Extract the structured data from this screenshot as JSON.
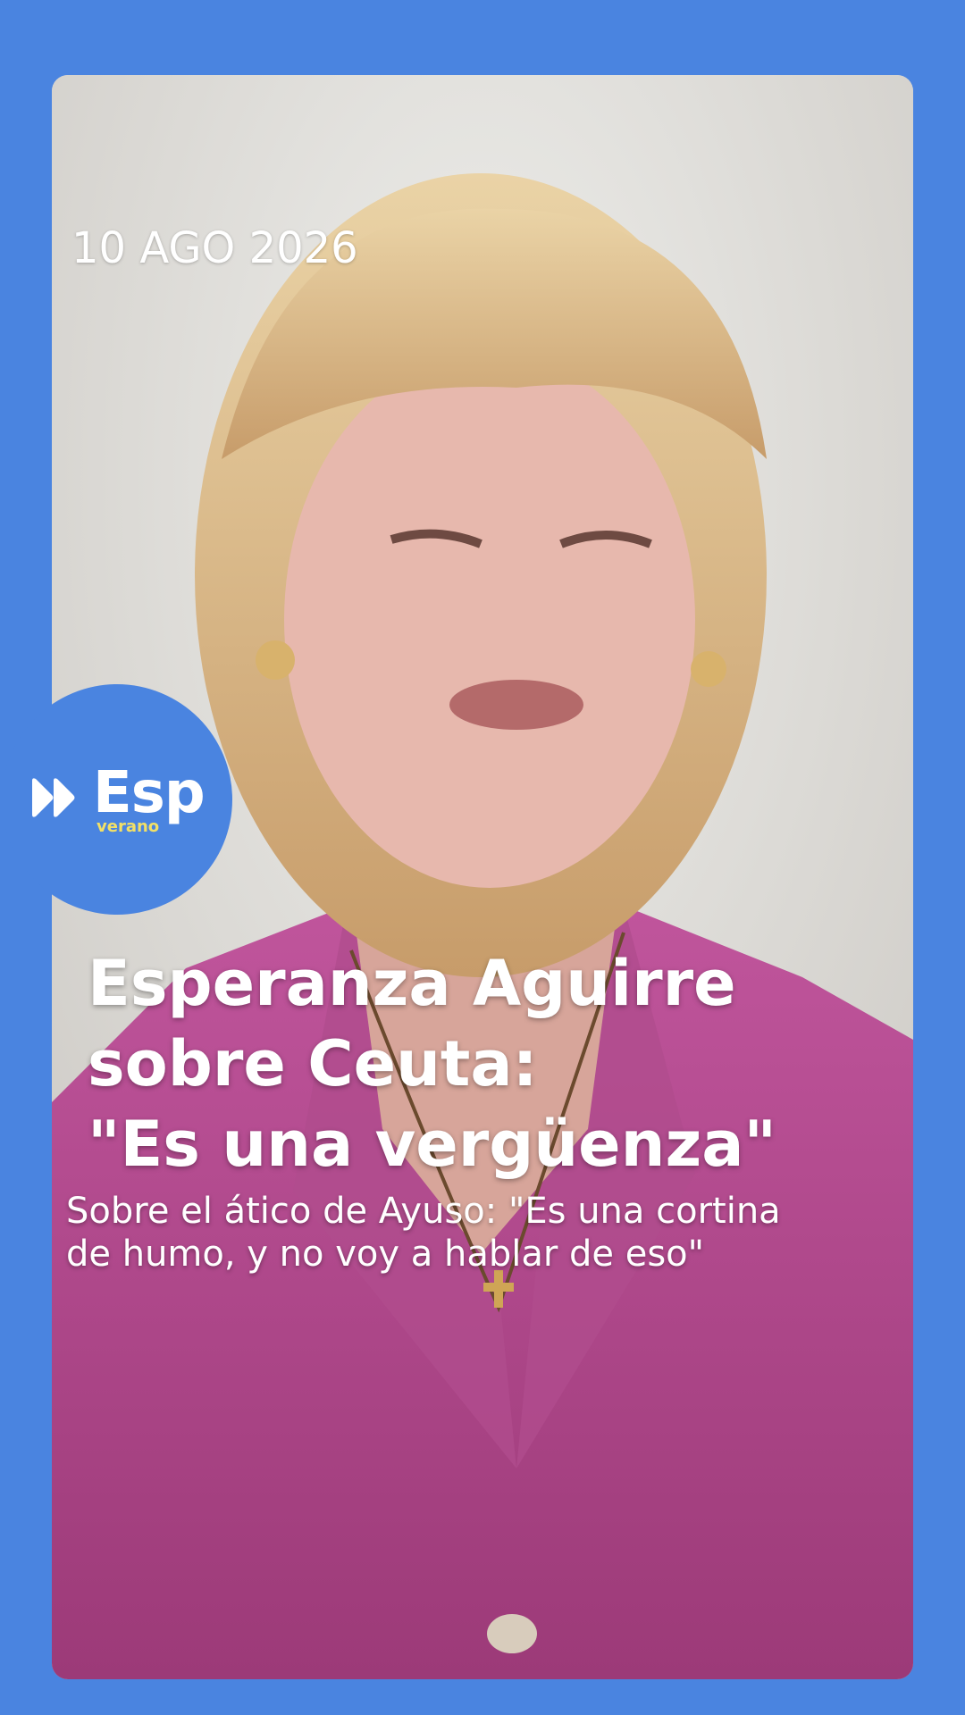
{
  "story": {
    "date": "10 AGO 2026",
    "headline_line1": "Esperanza Aguirre",
    "headline_line2": "sobre Ceuta:",
    "headline_line3": "\"Es una vergüenza\"",
    "subhead_line1": "Sobre el ático de Ayuso: \"Es una cortina",
    "subhead_line2": "de humo, y no voy a hablar de eso\""
  },
  "brand": {
    "name": "Esp",
    "tagline": "verano",
    "logo_icon": "fast-forward-icon"
  },
  "colors": {
    "background": "#4a84e0",
    "brand_accent": "#f2e066",
    "text": "#ffffff"
  }
}
